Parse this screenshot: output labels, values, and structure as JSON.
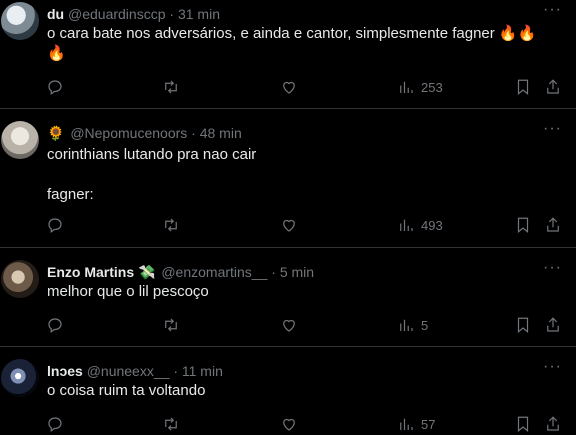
{
  "tweets": [
    {
      "name": "du",
      "handle": "@eduardinsccp",
      "separator": "·",
      "time": "31 min",
      "text": "o cara bate nos adversários, e ainda e cantor, simplesmente fagner 🔥🔥\n🔥",
      "views": "253"
    },
    {
      "name_prefix_emoji": "🌻",
      "name": "",
      "handle": "@Nepomucenoors",
      "separator": "·",
      "time": "48 min",
      "text": "corinthians lutando pra nao cair\n\nfagner:",
      "views": "493"
    },
    {
      "name": "Enzo Martins",
      "name_suffix_emoji": "💸",
      "handle": "@enzomartins__",
      "separator": "·",
      "time": "5 min",
      "text": "melhor que o lil pescoço",
      "views": "5"
    },
    {
      "name": "lnɔes",
      "handle": "@nuneexx__",
      "separator": "·",
      "time": "11 min",
      "text": "o coisa ruim ta voltando",
      "views": "57"
    }
  ],
  "more_label": "···"
}
